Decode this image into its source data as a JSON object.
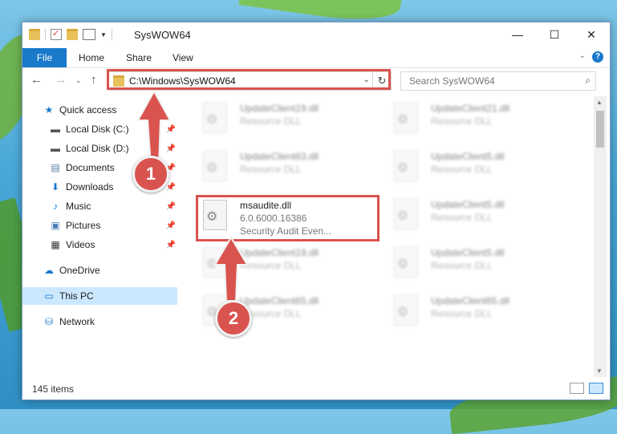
{
  "window": {
    "title": "SysWOW64"
  },
  "ribbon": {
    "file": "File",
    "tabs": [
      "Home",
      "Share",
      "View"
    ]
  },
  "address": {
    "path": "C:\\Windows\\SysWOW64"
  },
  "search": {
    "placeholder": "Search SysWOW64"
  },
  "sidebar": {
    "items": [
      {
        "label": "Quick access",
        "icon": "star-icon",
        "pinned": false
      },
      {
        "label": "Local Disk (C:)",
        "icon": "drive-icon",
        "pinned": true
      },
      {
        "label": "Local Disk (D:)",
        "icon": "drive-icon",
        "pinned": true
      },
      {
        "label": "Documents",
        "icon": "documents-icon",
        "pinned": true
      },
      {
        "label": "Downloads",
        "icon": "download-icon",
        "pinned": true
      },
      {
        "label": "Music",
        "icon": "music-icon",
        "pinned": true
      },
      {
        "label": "Pictures",
        "icon": "pictures-icon",
        "pinned": true
      },
      {
        "label": "Videos",
        "icon": "videos-icon",
        "pinned": true
      },
      {
        "label": "OneDrive",
        "icon": "cloud-icon",
        "pinned": false
      },
      {
        "label": "This PC",
        "icon": "computer-icon",
        "pinned": false
      },
      {
        "label": "Network",
        "icon": "network-icon",
        "pinned": false
      }
    ]
  },
  "files": {
    "left": [
      {
        "name": "UpdateClient19.dll",
        "type": "Resource DLL"
      },
      {
        "name": "UpdateClient63.dll",
        "type": "Resource DLL"
      },
      {
        "name": "msaudite.dll",
        "version": "6.0.6000.16386",
        "desc": "Security Audit Even..."
      },
      {
        "name": "UpdateClient19.dll",
        "type": "Resource DLL"
      },
      {
        "name": "UpdateClient65.dll",
        "type": "Resource DLL"
      }
    ],
    "right": [
      {
        "name": "UpdateClient21.dll",
        "type": "Resource DLL"
      },
      {
        "name": "UpdateClient5.dll",
        "type": "Resource DLL"
      },
      {
        "name": "UpdateClient5.dll",
        "type": "Resource DLL"
      },
      {
        "name": "UpdateClient5.dll",
        "type": "Resource DLL"
      },
      {
        "name": "UpdateClient65.dll",
        "type": "Resource DLL"
      }
    ]
  },
  "status": {
    "count": "145 items"
  },
  "annotations": {
    "badge1": "1",
    "badge2": "2",
    "accent": "#d9534f"
  }
}
